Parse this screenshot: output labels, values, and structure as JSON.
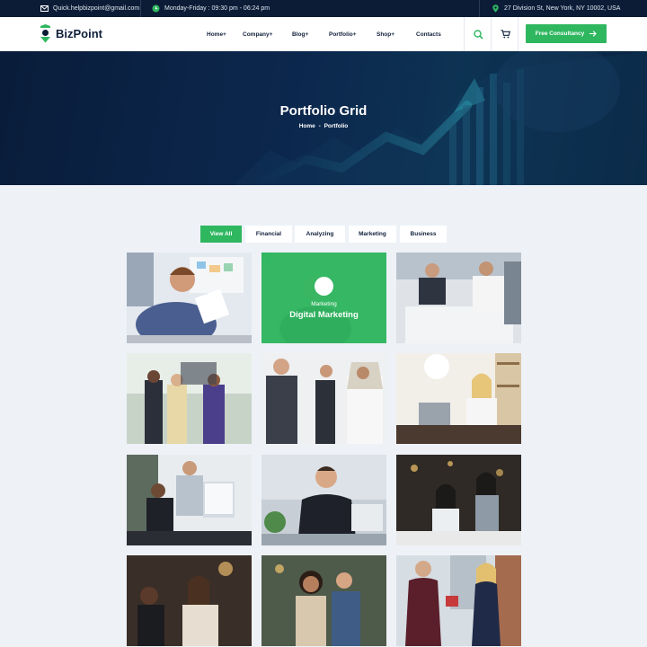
{
  "topbar": {
    "email": "Quick.helpbizpoint@gmail.com",
    "hours": "Monday-Friday : 09:30 pm - 06:24 pm",
    "address": "27 Division St, New York, NY 10002, USA",
    "icons": [
      "mail-icon",
      "clock-icon",
      "location-pin-icon"
    ]
  },
  "header": {
    "logo_text": "BizPoint",
    "nav": [
      "Home+",
      "Company+",
      "Blog+",
      "Portfolio+",
      "Shop+",
      "Contacts"
    ],
    "cta_label": "Free Consultancy",
    "icons": [
      "search-icon",
      "cart-icon",
      "arrow-right-icon"
    ]
  },
  "hero": {
    "title": "Portfolio Grid",
    "breadcrumb_home": "Home",
    "breadcrumb_sep": "-",
    "breadcrumb_current": "Portfolio"
  },
  "filters": {
    "items": [
      "View All",
      "Financial",
      "Analyzing",
      "Marketing",
      "Business"
    ],
    "active": "View All"
  },
  "portfolio": {
    "hover_card": {
      "category": "Marketing",
      "title": "Digital Marketing",
      "icon": "expand-icon"
    }
  },
  "colors": {
    "accent": "#2fb760",
    "dark": "#0c1c36",
    "page_bg": "#eef2f7"
  }
}
